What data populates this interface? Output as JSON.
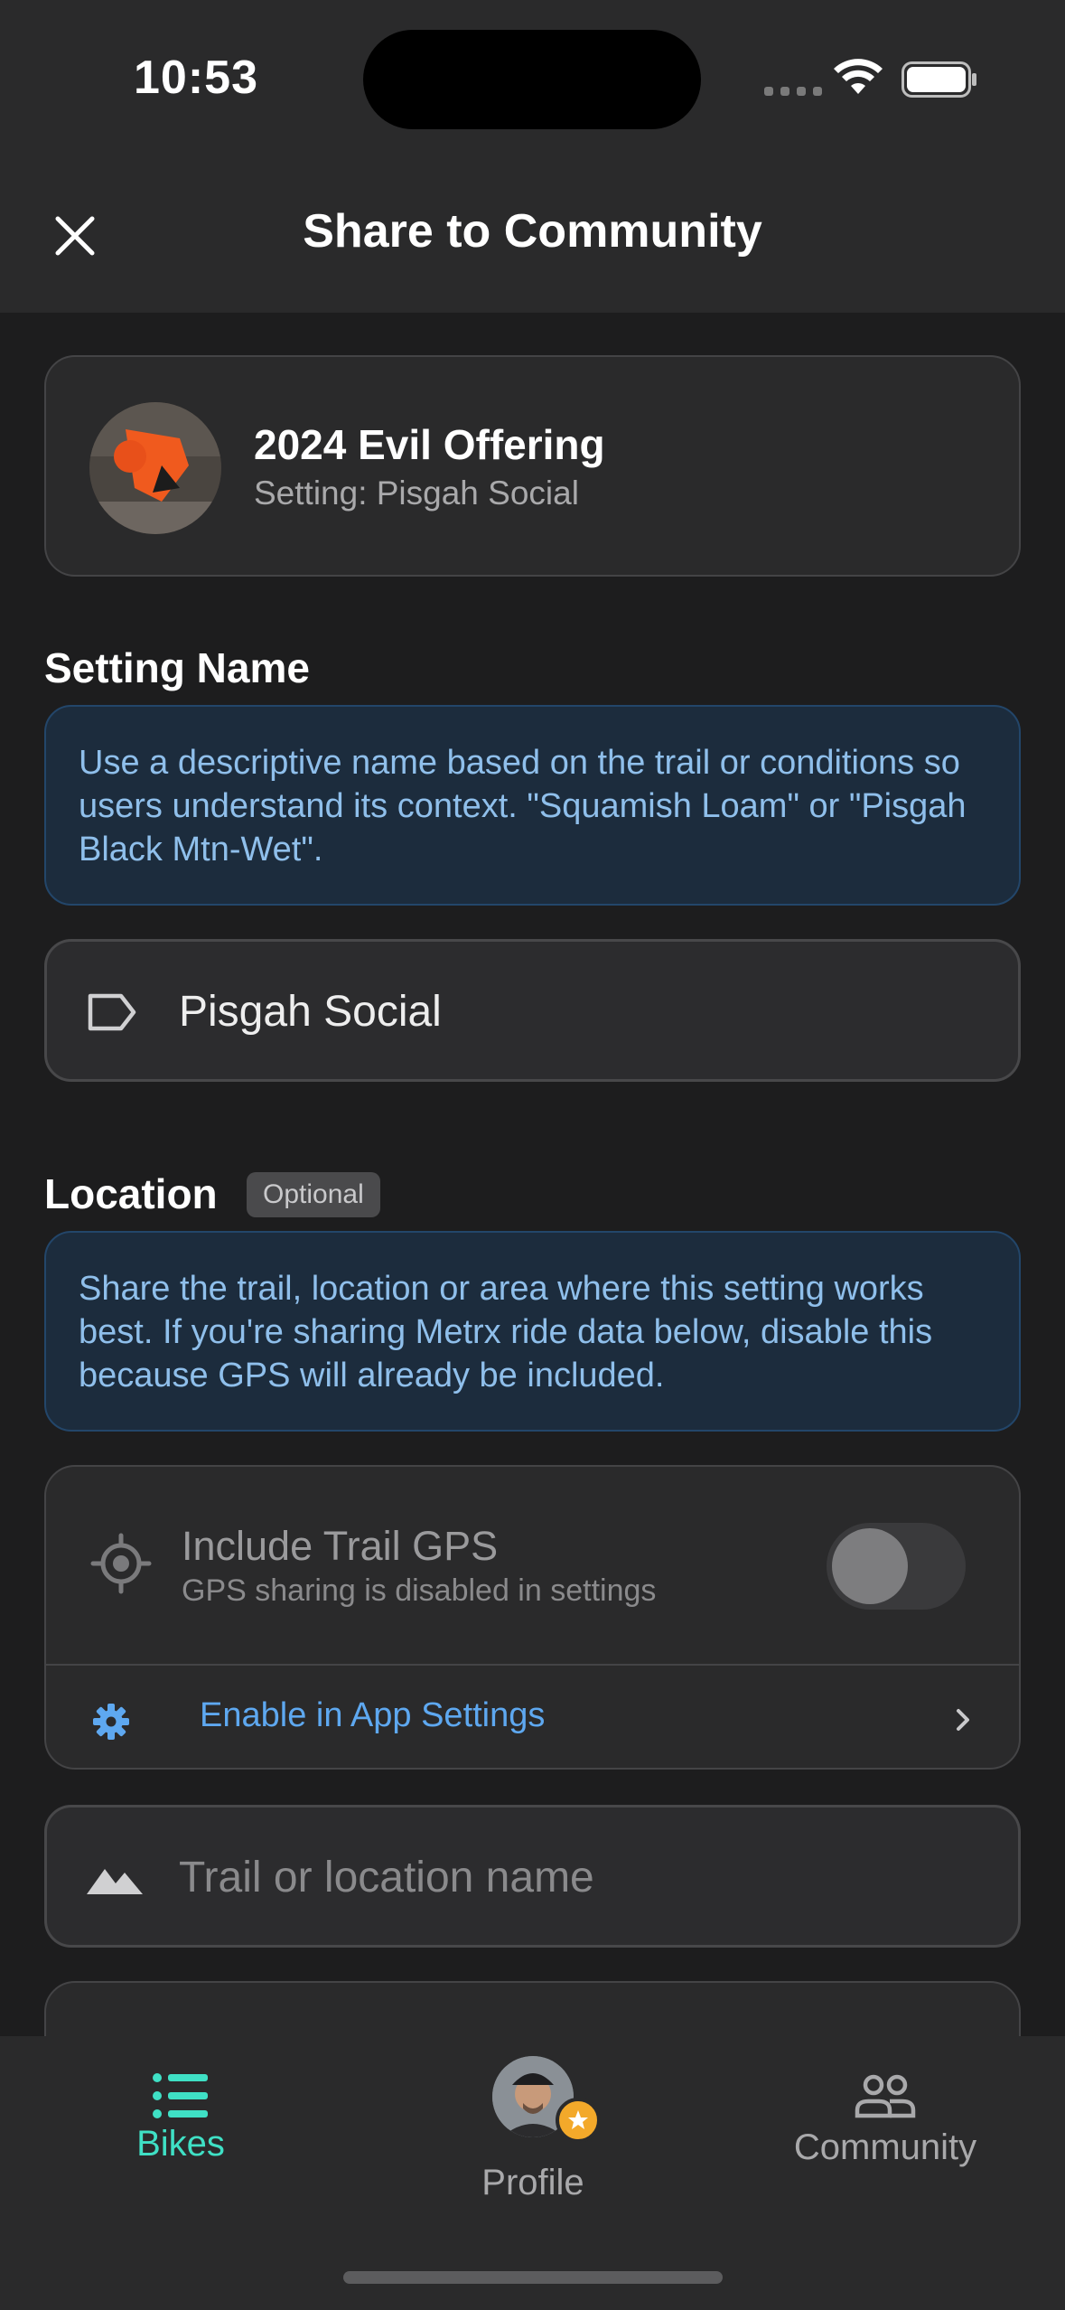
{
  "status_bar": {
    "time": "10:53"
  },
  "header": {
    "title": "Share to Community",
    "close_icon": "close-icon"
  },
  "bike": {
    "name": "2024 Evil Offering",
    "setting": "Setting: Pisgah Social"
  },
  "setting_name": {
    "label": "Setting Name",
    "info": "Use a descriptive name based on the trail or conditions so users understand its context. \"Squamish Loam\" or \"Pisgah Black Mtn-Wet\".",
    "value": "Pisgah Social",
    "icon": "tag-icon"
  },
  "location": {
    "label": "Location",
    "badge": "Optional",
    "info": "Share the trail, location or area where this setting works best. If you're sharing Metrx ride data below, disable this because GPS will already be included.",
    "gps_title": "Include Trail GPS",
    "gps_subtitle": "GPS sharing is disabled in settings",
    "gps_enabled": false,
    "settings_link": "Enable in App Settings",
    "trail_placeholder": "Trail or location name"
  },
  "tabbar": {
    "bikes": "Bikes",
    "profile": "Profile",
    "community": "Community"
  },
  "colors": {
    "accent": "#3fe0c5",
    "link": "#5ea8f0",
    "info_bg": "#1c2c3d",
    "info_text": "#8fbfeb",
    "star": "#f3a92a"
  }
}
